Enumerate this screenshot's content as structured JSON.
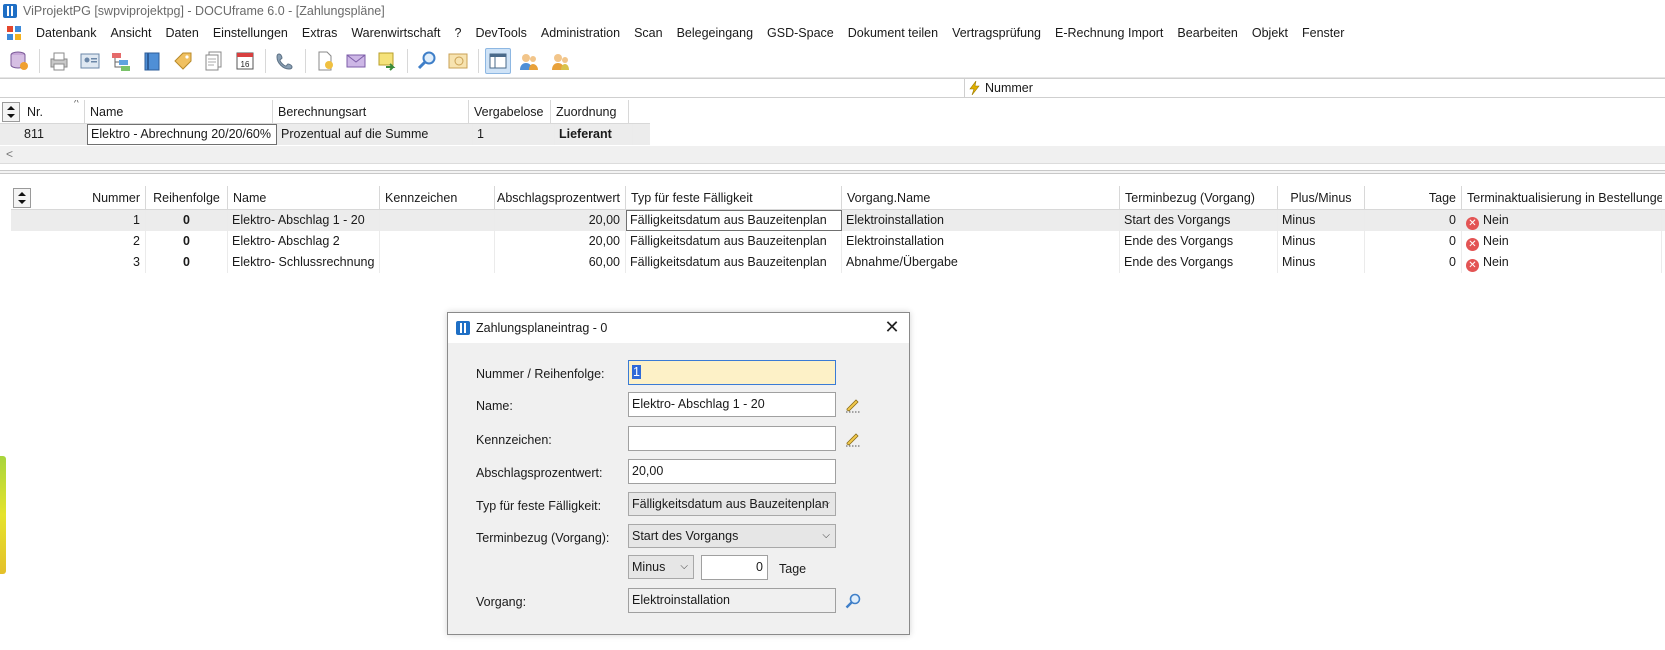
{
  "window": {
    "title": "ViProjektPG [swpviprojektpg] - DOCUframe 6.0 - [Zahlungspläne]"
  },
  "menu": [
    "Datenbank",
    "Ansicht",
    "Daten",
    "Einstellungen",
    "Extras",
    "Warenwirtschaft",
    "?",
    "DevTools",
    "Administration",
    "Scan",
    "Belegeingang",
    "GSD-Space",
    "Dokument teilen",
    "Vertragsprüfung",
    "E-Rechnung Import",
    "Bearbeiten",
    "Objekt",
    "Fenster"
  ],
  "filter": {
    "label": "Nummer"
  },
  "upper_grid": {
    "headers": [
      "Nr.",
      "Name",
      "Berechnungsart",
      "Vergabelose",
      "Zuordnung"
    ],
    "row": {
      "nr": "811",
      "name": "Elektro - Abrechnung 20/20/60%",
      "berechnungsart": "Prozentual auf die Summe",
      "vergabelose": "1",
      "zuordnung": "Lieferant"
    }
  },
  "lower_grid": {
    "headers": [
      "Nummer",
      "Reihenfolge",
      "Name",
      "Kennzeichen",
      "Abschlagsprozentwert",
      "Typ für feste Fälligkeit",
      "Vorgang.Name",
      "Terminbezug (Vorgang)",
      "Plus/Minus",
      "Tage",
      "Terminaktualisierung in Bestellungen"
    ],
    "rows": [
      [
        "1",
        "0",
        "Elektro- Abschlag 1 - 20",
        "",
        "20,00",
        "Fälligkeitsdatum aus Bauzeitenplan",
        "Elektroinstallation",
        "Start des Vorgangs",
        "Minus",
        "0",
        "Nein"
      ],
      [
        "2",
        "0",
        "Elektro- Abschlag 2",
        "",
        "20,00",
        "Fälligkeitsdatum aus Bauzeitenplan",
        "Elektroinstallation",
        "Ende des Vorgangs",
        "Minus",
        "0",
        "Nein"
      ],
      [
        "3",
        "0",
        "Elektro- Schlussrechnung",
        "",
        "60,00",
        "Fälligkeitsdatum aus Bauzeitenplan",
        "Abnahme/Übergabe",
        "Ende des Vorgangs",
        "Minus",
        "0",
        "Nein"
      ]
    ]
  },
  "dialog": {
    "title": "Zahlungsplaneintrag - 0",
    "close": "✕",
    "labels": {
      "nummer": "Nummer / Reihenfolge:",
      "name": "Name:",
      "kennzeichen": "Kennzeichen:",
      "prozent": "Abschlagsprozentwert:",
      "typ": "Typ für feste Fälligkeit:",
      "terminbezug": "Terminbezug (Vorgang):",
      "tage": "Tage",
      "vorgang": "Vorgang:"
    },
    "values": {
      "nummer": "1",
      "name": "Elektro- Abschlag 1 - 20",
      "kennzeichen": "",
      "prozent": "20,00",
      "typ": "Fälligkeitsdatum aus Bauzeitenplan",
      "terminbezug": "Start des Vorgangs",
      "plusminus": "Minus",
      "tage": "0",
      "vorgang": "Elektroinstallation"
    }
  }
}
